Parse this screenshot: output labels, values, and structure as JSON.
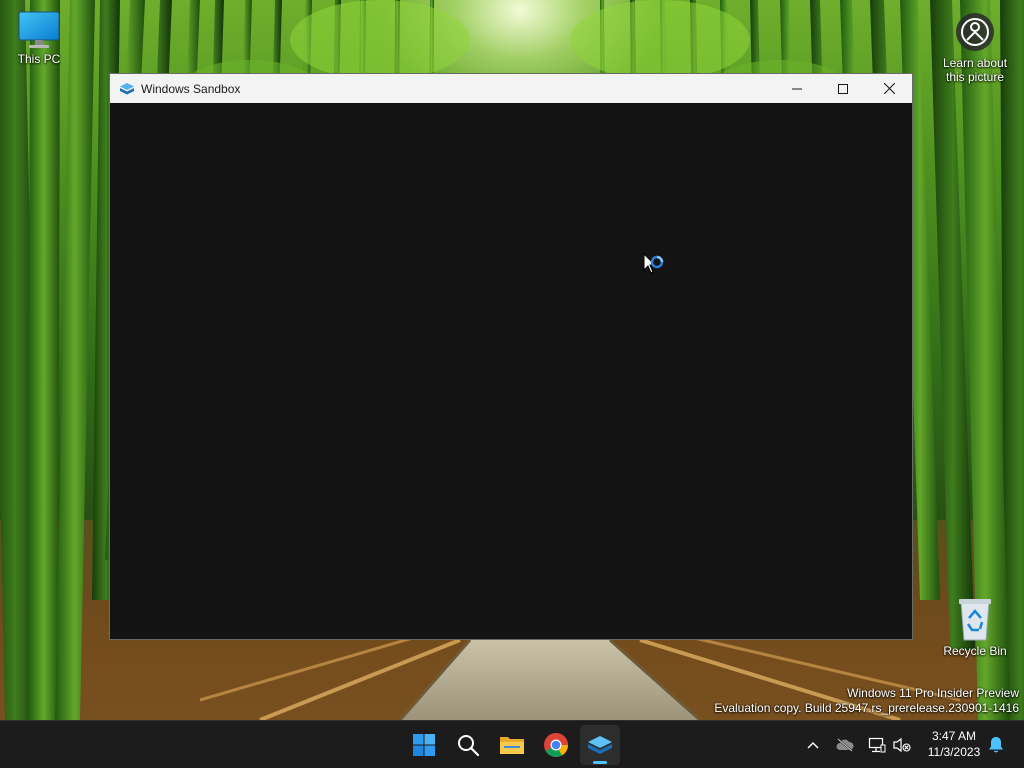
{
  "desktop": {
    "this_pc_label": "This PC",
    "learn_label_line1": "Learn about",
    "learn_label_line2": "this picture",
    "recycle_bin_label": "Recycle Bin"
  },
  "watermark": {
    "line1": "Windows 11 Pro Insider Preview",
    "line2": "Evaluation copy. Build 25947.rs_prerelease.230901-1416"
  },
  "window": {
    "title": "Windows Sandbox",
    "content_state": "loading"
  },
  "taskbar": {
    "pinned": [
      {
        "name": "start",
        "icon": "windows-logo-icon"
      },
      {
        "name": "search",
        "icon": "search-icon"
      },
      {
        "name": "file-explorer",
        "icon": "folder-icon"
      },
      {
        "name": "chrome",
        "icon": "chrome-icon"
      },
      {
        "name": "windows-sandbox",
        "icon": "sandbox-icon",
        "active": true
      }
    ],
    "tray": {
      "chevron": "chevron-up-icon",
      "onedrive": "cloud-offline-icon",
      "network": "network-icon",
      "volume": "volume-muted-icon",
      "notifications": "bell-icon"
    },
    "clock_time": "3:47 AM",
    "clock_date": "11/3/2023"
  },
  "colors": {
    "accent": "#4cc2ff",
    "taskbar": "#1c1c1c",
    "titlebar": "#f3f3f3",
    "window_client": "#131313"
  }
}
